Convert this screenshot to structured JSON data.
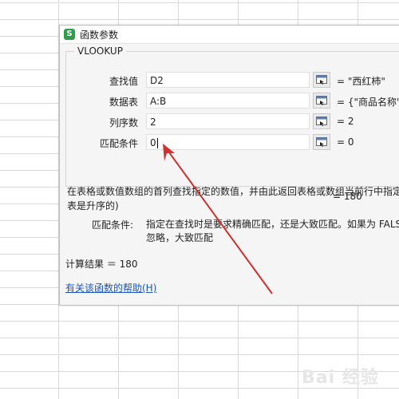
{
  "dialog": {
    "title": "函数参数",
    "app_icon_glyph": "S",
    "function_name": "VLOOKUP",
    "params": [
      {
        "label": "查找值",
        "value": "D2",
        "result": "= \"西红柿\""
      },
      {
        "label": "数据表",
        "value": "A:B",
        "result": "= {\"商品名称\",\""
      },
      {
        "label": "列序数",
        "value": "2",
        "result": "= 2"
      },
      {
        "label": "匹配条件",
        "value": "0",
        "result": "= 0"
      }
    ],
    "overall_result": "= 180",
    "description_line1": "在表格或数值数组的首列查找指定的数值，并由此返回表格或数组当前行中指定",
    "description_line2": "表是升序的)",
    "arg_desc_label": "匹配条件:",
    "arg_desc_line1": "指定在查找时是要求精确匹配，还是大致匹配。如果为 FALS",
    "arg_desc_line2": "忽略，大致匹配",
    "calc_result": "计算结果 ＝ 180",
    "help_link": "有关该函数的帮助(H)"
  },
  "watermark": "Bai 经验",
  "colors": {
    "arrow": "#d0312d",
    "link": "#1a55c7",
    "app_icon": "#2e9e4b"
  },
  "icons": [
    "app-icon",
    "range-select-icon"
  ]
}
